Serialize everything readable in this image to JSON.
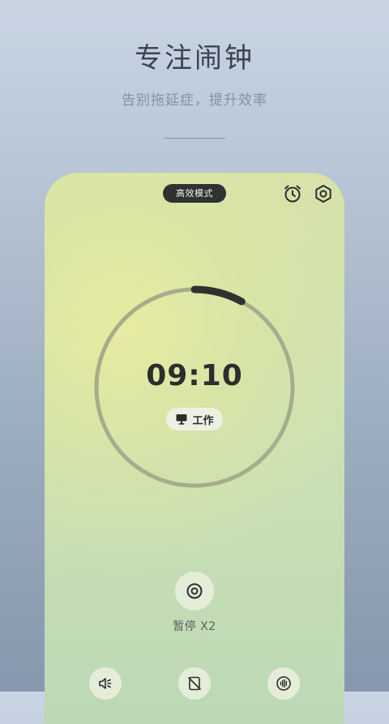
{
  "header": {
    "title": "专注闹钟",
    "subtitle": "告别拖延症，提升效率"
  },
  "phone": {
    "mode_pill": "高效模式",
    "timer": {
      "time": "09:10",
      "progress": 0.08
    },
    "tag": {
      "icon": "monitor-icon",
      "label": "工作"
    },
    "pause": {
      "icon": "target-icon",
      "label": "暂停 X2"
    },
    "bottom_bar": [
      {
        "name": "sound-icon"
      },
      {
        "name": "screen-off-icon"
      },
      {
        "name": "white-noise-icon"
      }
    ]
  },
  "colors": {
    "ring_track": "#a6ad8c",
    "ring_progress": "#2e3230",
    "pill_bg": "#2e3230"
  }
}
